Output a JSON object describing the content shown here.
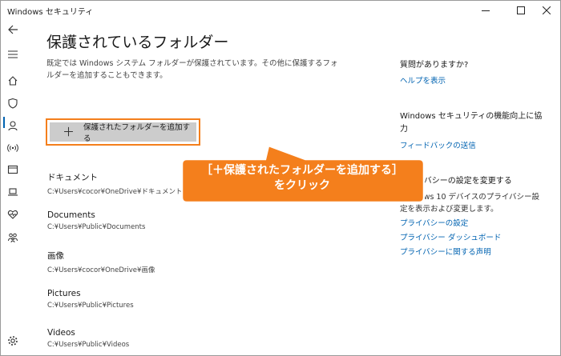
{
  "window": {
    "title": "Windows セキュリティ",
    "controls": {
      "minimize": "minimize-icon",
      "maximize": "maximize-icon",
      "close": "close-icon"
    }
  },
  "rail": {
    "items": [
      {
        "icon": "back-arrow-icon"
      },
      {
        "icon": "hamburger-menu-icon"
      },
      {
        "icon": "home-icon"
      },
      {
        "icon": "shield-icon",
        "selected": true
      },
      {
        "icon": "person-icon"
      },
      {
        "icon": "wireless-icon"
      },
      {
        "icon": "app-browser-icon"
      },
      {
        "icon": "laptop-icon"
      },
      {
        "icon": "heart-icon"
      },
      {
        "icon": "family-icon"
      },
      {
        "icon": "gear-icon"
      }
    ],
    "accent": "#0063b1"
  },
  "main": {
    "title": "保護されているフォルダー",
    "description": "既定では Windows システム フォルダーが保護されています。その他に保護するフォルダーを追加することもできます。",
    "add_button": {
      "icon": "plus-icon",
      "plus": "＋",
      "label": "保護されたフォルダーを追加する",
      "highlight_color": "#f47f1c"
    },
    "folders": [
      {
        "name": "ドキュメント",
        "path": "C:¥Users¥cocor¥OneDrive¥ドキュメント"
      },
      {
        "name": "Documents",
        "path": "C:¥Users¥Public¥Documents"
      },
      {
        "name": "画像",
        "path": "C:¥Users¥cocor¥OneDrive¥画像"
      },
      {
        "name": "Pictures",
        "path": "C:¥Users¥Public¥Pictures"
      },
      {
        "name": "Videos",
        "path": "C:¥Users¥Public¥Videos"
      }
    ]
  },
  "side": {
    "question": {
      "heading": "質問がありますか?",
      "link": "ヘルプを表示"
    },
    "feedback": {
      "heading": "Windows セキュリティの機能向上に協力",
      "link": "フィードバックの送信"
    },
    "privacy": {
      "heading": "プライバシーの設定を変更する",
      "text": "Windows 10 デバイスのプライバシー設定を表示および変更します。",
      "links": [
        "プライバシーの設定",
        "プライバシー ダッシュボード",
        "プライバシーに関する声明"
      ]
    }
  },
  "callout": {
    "line1": "［＋保護されたフォルダーを追加する］",
    "line2": "をクリック",
    "color": "#f47f1c"
  }
}
